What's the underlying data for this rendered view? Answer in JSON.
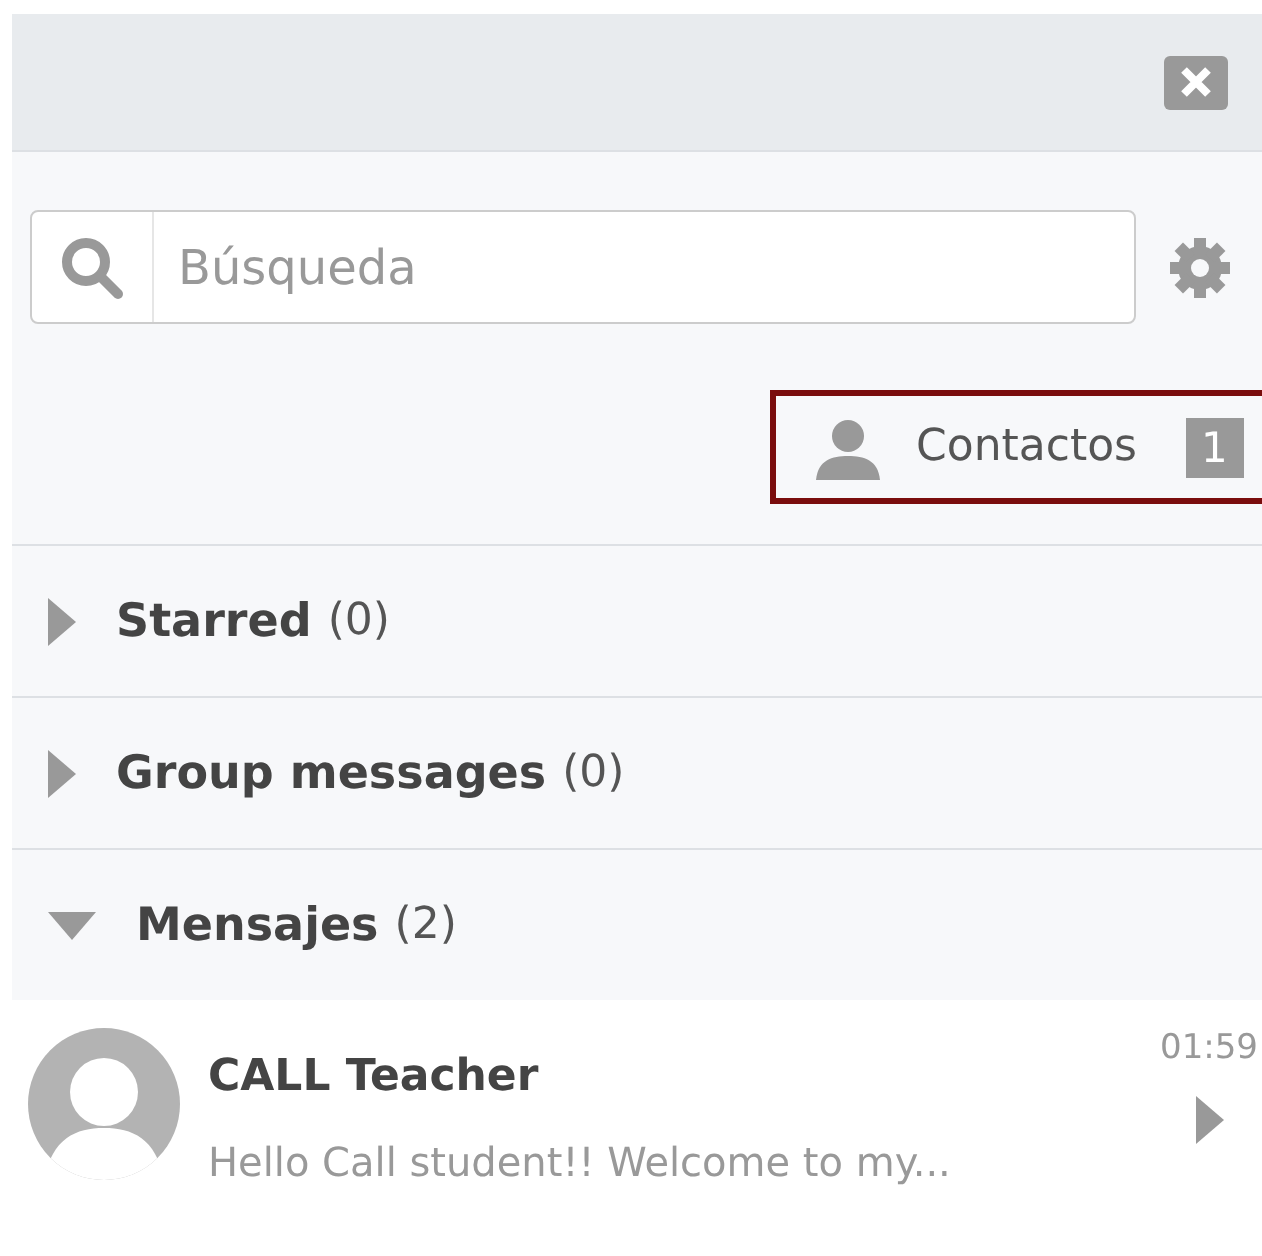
{
  "search": {
    "placeholder": "Búsqueda"
  },
  "contacts": {
    "label": "Contactos",
    "count": "1",
    "selected": true
  },
  "sections": [
    {
      "name": "Starred",
      "count": "(0)",
      "expanded": false
    },
    {
      "name": "Group messages",
      "count": "(0)",
      "expanded": false
    },
    {
      "name": "Mensajes",
      "count": "(2)",
      "expanded": true
    }
  ],
  "messages": [
    {
      "sender": "CALL Teacher",
      "preview": "Hello Call student!! Welcome to my...",
      "time": "01:59"
    }
  ]
}
